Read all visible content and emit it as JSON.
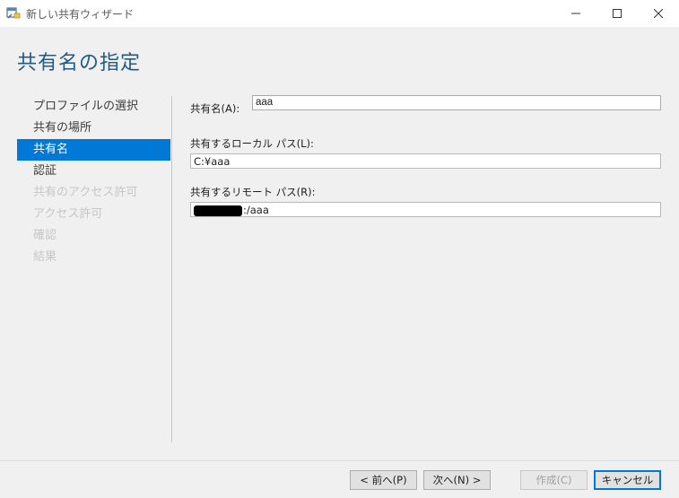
{
  "window": {
    "title": "新しい共有ウィザード",
    "icons": {
      "app": "share-folder-icon",
      "minimize": "minimize-icon",
      "maximize": "maximize-icon",
      "close": "close-icon"
    }
  },
  "page": {
    "title": "共有名の指定"
  },
  "nav": {
    "items": [
      {
        "label": "プロファイルの選択",
        "state": "normal"
      },
      {
        "label": "共有の場所",
        "state": "normal"
      },
      {
        "label": "共有名",
        "state": "active"
      },
      {
        "label": "認証",
        "state": "normal"
      },
      {
        "label": "共有のアクセス許可",
        "state": "disabled"
      },
      {
        "label": "アクセス許可",
        "state": "disabled"
      },
      {
        "label": "確認",
        "state": "disabled"
      },
      {
        "label": "結果",
        "state": "disabled"
      }
    ]
  },
  "form": {
    "share_name_label": "共有名(A):",
    "share_name_value": "aaa",
    "local_path_label": "共有するローカル パス(L):",
    "local_path_value": "C:¥aaa",
    "remote_path_label": "共有するリモート パス(R):",
    "remote_path_value": ":/aaa"
  },
  "footer": {
    "back_label": "< 前へ(P)",
    "next_label": "次へ(N) >",
    "create_label": "作成(C)",
    "cancel_label": "キャンセル"
  },
  "colors": {
    "accent": "#0078d7",
    "title_text": "#1e5a8a"
  }
}
